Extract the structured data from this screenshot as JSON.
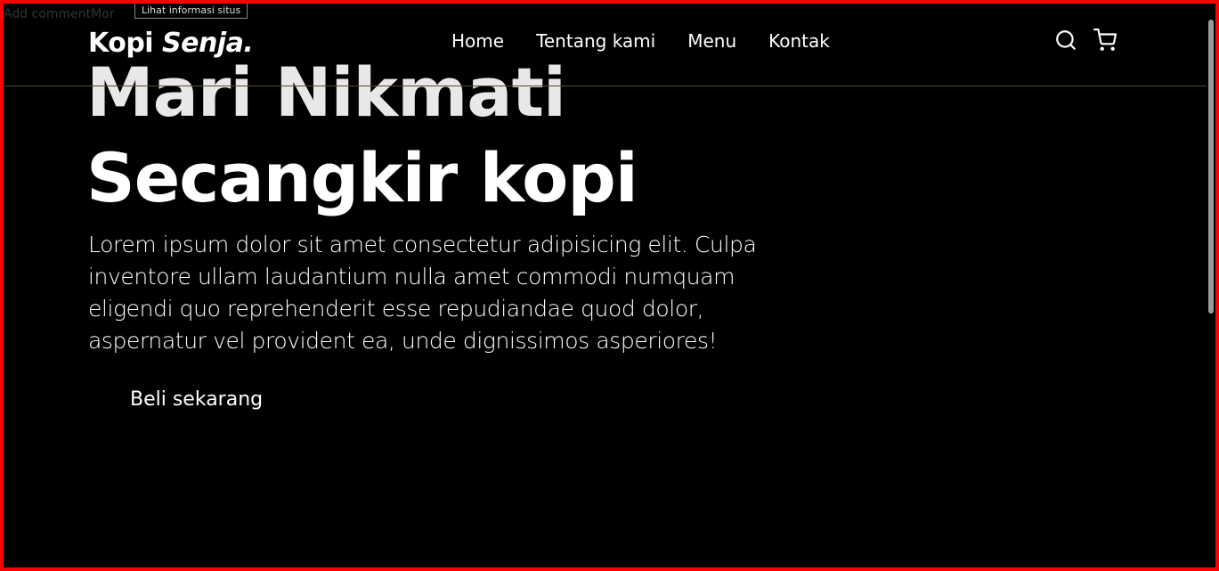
{
  "overlay": {
    "comment_text": "Add commentMor",
    "tooltip": "Lihat informasi situs"
  },
  "header": {
    "logo_main": "Kopi",
    "logo_italic": "Senja.",
    "nav": [
      {
        "label": "Home"
      },
      {
        "label": "Tentang kami"
      },
      {
        "label": "Menu"
      },
      {
        "label": "Kontak"
      }
    ],
    "icons": [
      "search-icon",
      "cart-icon"
    ]
  },
  "hero": {
    "title_line1": "Mari Nikmati",
    "title_line2": "Secangkir kopi",
    "description": "Lorem ipsum dolor sit amet consectetur adipisicing elit. Culpa inventore ullam laudantium nulla amet commodi numquam eligendi quo reprehenderit esse repudiandae quod dolor, aspernatur vel provident ea, unde dignissimos asperiores!",
    "cta_label": "Beli sekarang"
  },
  "colors": {
    "background": "#000000",
    "border": "#ff0000",
    "text": "#ffffff"
  }
}
